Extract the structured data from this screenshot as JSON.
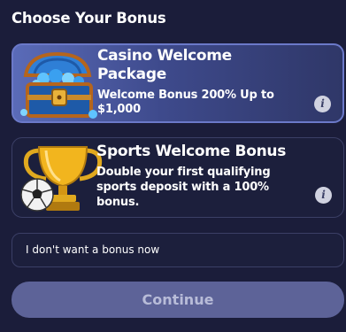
{
  "header": {
    "title": "Choose Your Bonus"
  },
  "bonuses": [
    {
      "title_line1": "Casino Welcome",
      "title_line2": "Package",
      "desc_line1": "Welcome Bonus 200% Up to",
      "desc_line2": "$1,000",
      "icon": "treasure-chest-icon",
      "info_icon": "i",
      "selected": true
    },
    {
      "title_line1": "Sports Welcome Bonus",
      "desc_line1": "Double your first qualifying",
      "desc_line2": "sports deposit with a 100%",
      "desc_line3": "bonus.",
      "icon": "trophy-soccer-icon",
      "info_icon": "i",
      "selected": false
    }
  ],
  "no_bonus": {
    "label": "I don't want a bonus now"
  },
  "footer": {
    "continue_label": "Continue"
  },
  "colors": {
    "background": "#1b1d3a",
    "selected_card": "#4a5aa8",
    "continue_button": "#5d6398"
  }
}
